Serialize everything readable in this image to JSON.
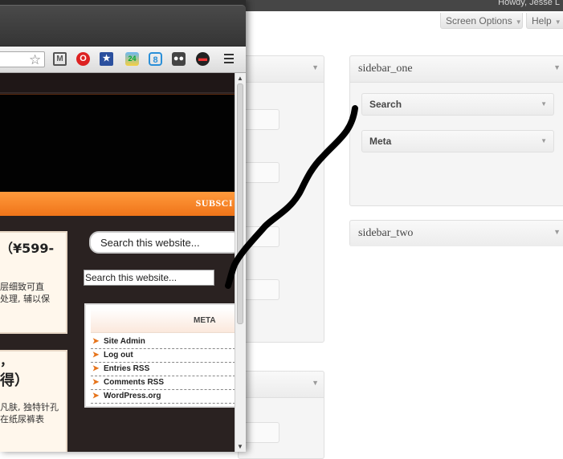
{
  "admin": {
    "howdy": "Howdy, Jesse L",
    "screen_options": "Screen Options",
    "help": "Help"
  },
  "panels": {
    "sidebar_one": {
      "title": "sidebar_one",
      "widgets": [
        "Search",
        "Meta"
      ]
    },
    "sidebar_two": {
      "title": "sidebar_two"
    }
  },
  "browser": {
    "toolbar_icons": [
      "star-icon",
      "gmail-icon",
      "opera-icon",
      "bookmark-icon",
      "weather-icon",
      "circle-icon",
      "glasses-icon",
      "mask-icon",
      "menu-icon"
    ],
    "weather_badge": "24"
  },
  "site": {
    "nav_subscribe": "SUBSCI",
    "post1": {
      "title": "（¥599-",
      "excerpt_line1": "层细致可直",
      "excerpt_line2": "处理, 辅以保"
    },
    "post2": {
      "title_line1": "，",
      "title_line2": "得）",
      "excerpt_line1": "凡肤, 独特针孔",
      "excerpt_line2": "在纸尿裤表"
    },
    "search_placeholder": "Search this website...",
    "search_placeholder_2": "Search this website...",
    "meta": {
      "title": "META",
      "items": [
        "Site Admin",
        "Log out",
        "Entries RSS",
        "Comments RSS",
        "WordPress.org"
      ]
    }
  },
  "colors": {
    "nav_orange": "#f5852b",
    "post_bg": "#fff7ec",
    "bullet_orange": "#e6731a",
    "marker": "#000000"
  }
}
